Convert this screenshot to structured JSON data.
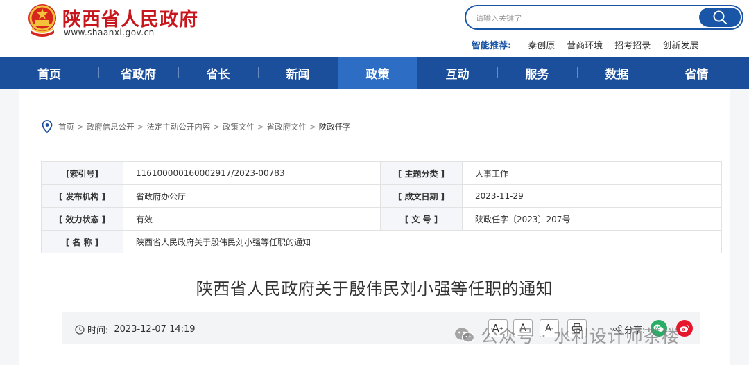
{
  "header": {
    "site_name": "陕西省人民政府",
    "site_domain": "www.shaanxi.gov.cn"
  },
  "search": {
    "placeholder": "请输入关键字"
  },
  "smart_recommend": {
    "label": "智能推荐:",
    "links": [
      "秦创原",
      "营商环境",
      "招考招录",
      "创新发展"
    ]
  },
  "nav": {
    "items": [
      "首页",
      "省政府",
      "省长",
      "新闻",
      "政策",
      "互动",
      "服务",
      "数据",
      "省情"
    ],
    "active": "政策"
  },
  "breadcrumb": {
    "items": [
      "首页",
      "政府信息公开",
      "法定主动公开内容",
      "政策文件",
      "省政府文件"
    ],
    "current": "陕政任字",
    "separator": ">"
  },
  "info_table": {
    "index_label": "[索引号]",
    "index_value": "116100000160002917/2023-00783",
    "topic_label": "[ 主题分类 ]",
    "topic_value": "人事工作",
    "publisher_label": "[ 发布机构 ]",
    "publisher_value": "省政府办公厅",
    "date_label": "[ 成文日期 ]",
    "date_value": "2023-11-29",
    "status_label": "[ 效力状态 ]",
    "status_value": "有效",
    "doc_no_label": "[ 文 号 ]",
    "doc_no_value": "陕政任字〔2023〕207号",
    "name_label": "[ 名 称 ]",
    "name_value": "陕西省人民政府关于殷伟民刘小强等任职的通知"
  },
  "document": {
    "title": "陕西省人民政府关于殷伟民刘小强等任职的通知",
    "time_label": "时间:",
    "time_value": "2023-12-07 14:19"
  },
  "toolbar": {
    "font_large": "A",
    "font_medium": "A",
    "font_small": "A",
    "share_label": "分享:"
  },
  "watermark": {
    "text": "公众号 · 水利设计师茶楼"
  },
  "colors": {
    "brand_red": "#c8161d",
    "nav_blue": "#1b4f9c",
    "nav_active": "#2e6dc4",
    "wechat_green": "#2aae67",
    "weibo_red": "#e6162d"
  }
}
